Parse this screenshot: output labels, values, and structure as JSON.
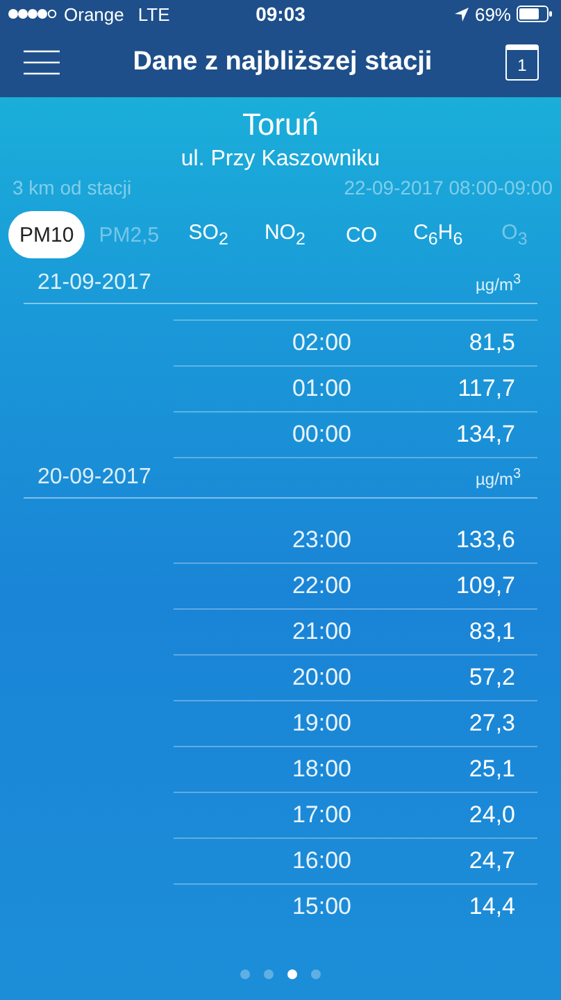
{
  "status_bar": {
    "carrier": "Orange",
    "network": "LTE",
    "time": "09:03",
    "battery": "69%"
  },
  "nav_bar": {
    "title": "Dane z najbliższej stacji",
    "calendar_day": "1"
  },
  "station": {
    "city": "Toruń",
    "street": "ul. Przy Kaszowniku",
    "distance": "3 km od stacji",
    "period": "22-09-2017 08:00-09:00"
  },
  "tabs": [
    {
      "label": "PM10",
      "selected": true,
      "disabled": false
    },
    {
      "label": "PM2,5",
      "selected": false,
      "disabled": true
    },
    {
      "label": "SO$_{2}$",
      "selected": false,
      "disabled": false
    },
    {
      "label": "NO$_{2}$",
      "selected": false,
      "disabled": false
    },
    {
      "label": "CO",
      "selected": false,
      "disabled": false
    },
    {
      "label": "C$_{6}$H$_{6}$",
      "selected": false,
      "disabled": false
    },
    {
      "label": "O$_{3}$",
      "selected": false,
      "disabled": true
    }
  ],
  "days": [
    {
      "date": "21-09-2017",
      "unit": "µg/m$^{3}$",
      "rows": [
        {
          "time": "02:00",
          "value": "81,5"
        },
        {
          "time": "01:00",
          "value": "117,7"
        },
        {
          "time": "00:00",
          "value": "134,7"
        }
      ]
    },
    {
      "date": "20-09-2017",
      "unit": "µg/m$^{3}$",
      "rows": [
        {
          "time": "23:00",
          "value": "133,6"
        },
        {
          "time": "22:00",
          "value": "109,7"
        },
        {
          "time": "21:00",
          "value": "83,1"
        },
        {
          "time": "20:00",
          "value": "57,2"
        },
        {
          "time": "19:00",
          "value": "27,3"
        },
        {
          "time": "18:00",
          "value": "25,1"
        },
        {
          "time": "17:00",
          "value": "24,0"
        },
        {
          "time": "16:00",
          "value": "24,7"
        },
        {
          "time": "15:00",
          "value": "14,4"
        }
      ]
    }
  ],
  "pages": [
    {
      "selected": false
    },
    {
      "selected": false
    },
    {
      "selected": true
    },
    {
      "selected": false
    }
  ]
}
